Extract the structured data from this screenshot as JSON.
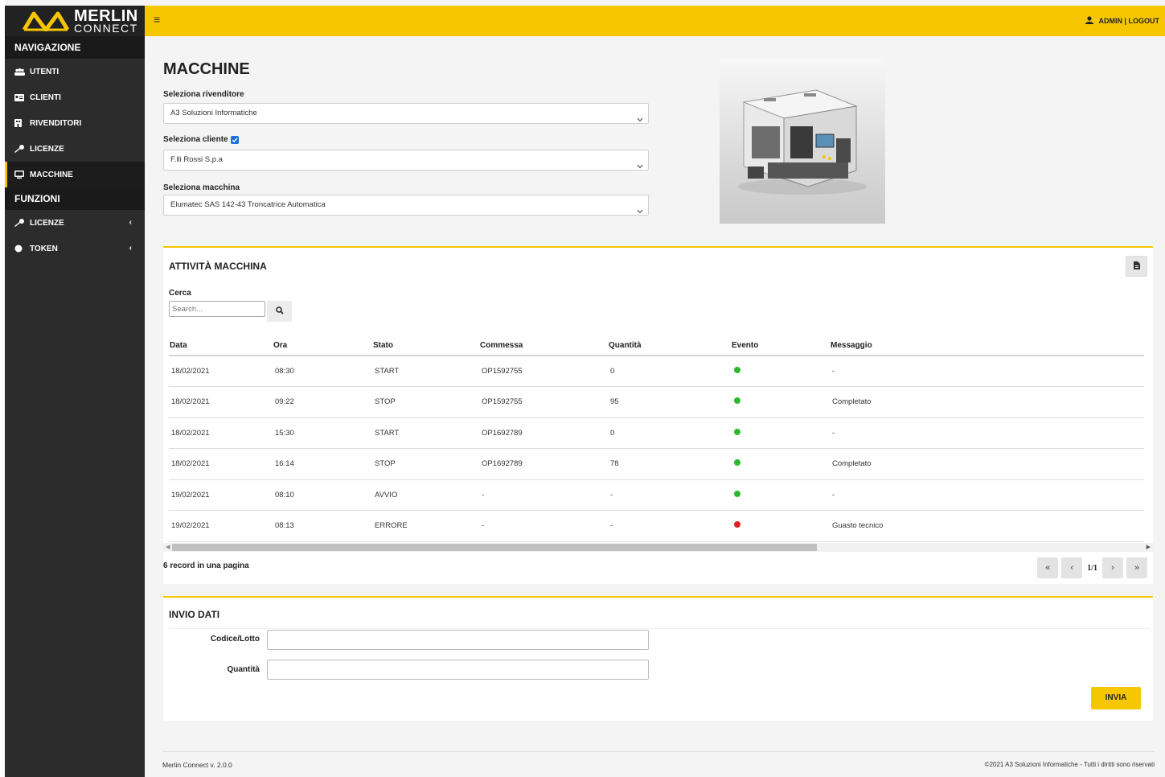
{
  "brand": {
    "name_top": "MERLIN",
    "name_bottom": "CONNECT",
    "accent": "#f6c700"
  },
  "topbar": {
    "menu_icon": "hamburger-icon",
    "user_text": "ADMIN | LOGOUT"
  },
  "sidebar": {
    "sections": [
      {
        "title": "NAVIGAZIONE",
        "items": [
          {
            "label": "UTENTI",
            "icon": "users-icon"
          },
          {
            "label": "CLIENTI",
            "icon": "id-card-icon"
          },
          {
            "label": "RIVENDITORI",
            "icon": "building-icon"
          },
          {
            "label": "LICENZE",
            "icon": "key-icon"
          },
          {
            "label": "MACCHINE",
            "icon": "desktop-icon",
            "active": true
          }
        ]
      },
      {
        "title": "FUNZIONI",
        "items": [
          {
            "label": "LICENZE",
            "icon": "key-icon"
          },
          {
            "label": "TOKEN",
            "icon": "circle-icon"
          }
        ]
      }
    ]
  },
  "page": {
    "title": "MACCHINE",
    "reseller_label": "Seleziona rivenditore",
    "reseller_value": "A3 Soluzioni Informatiche",
    "client_label": "Seleziona cliente",
    "client_checked": true,
    "client_value": "F.lli Rossi S.p.a",
    "machine_label": "Seleziona macchina",
    "machine_value": "Elumatec SAS 142-43 Troncatrice Automatica"
  },
  "activity": {
    "title": "ATTIVITÀ MACCHINA",
    "search_label": "Cerca",
    "search_placeholder": "Search...",
    "columns": [
      "Data",
      "Ora",
      "Stato",
      "Commessa",
      "Quantità",
      "Evento",
      "Messaggio"
    ],
    "rows": [
      {
        "data": "18/02/2021",
        "ora": "08:30",
        "stato": "START",
        "commessa": "OP1592755",
        "quantita": "0",
        "evento": "green",
        "messaggio": "-"
      },
      {
        "data": "18/02/2021",
        "ora": "09:22",
        "stato": "STOP",
        "commessa": "OP1592755",
        "quantita": "95",
        "evento": "green",
        "messaggio": "Completato"
      },
      {
        "data": "18/02/2021",
        "ora": "15:30",
        "stato": "START",
        "commessa": "OP1692789",
        "quantita": "0",
        "evento": "green",
        "messaggio": "-"
      },
      {
        "data": "18/02/2021",
        "ora": "16:14",
        "stato": "STOP",
        "commessa": "OP1692789",
        "quantita": "78",
        "evento": "green",
        "messaggio": "Completato"
      },
      {
        "data": "19/02/2021",
        "ora": "08:10",
        "stato": "AVVIO",
        "commessa": "-",
        "quantita": "-",
        "evento": "green",
        "messaggio": "-"
      },
      {
        "data": "19/02/2021",
        "ora": "08:13",
        "stato": "ERRORE",
        "commessa": "-",
        "quantita": "-",
        "evento": "red",
        "messaggio": "Guasto tecnico"
      }
    ],
    "event_colors": {
      "green": "#2db92d",
      "red": "#e02020"
    },
    "record_info": "6 record in una pagina",
    "page_indicator": "1/1"
  },
  "invio": {
    "title": "INVIO DATI",
    "code_label": "Codice/Lotto",
    "qty_label": "Quantità",
    "submit_label": "INVIA"
  },
  "footer": {
    "version": "Merlin Connect v. 2.0.0",
    "copyright": "©2021 A3 Soluzioni Informatiche - Tutti i diritti sono riservati"
  }
}
